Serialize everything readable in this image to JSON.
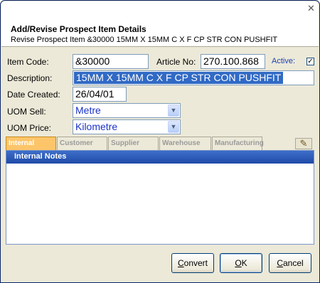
{
  "header": {
    "close_glyph": "✕",
    "title": "Add/Revise Prospect Item Details",
    "subtitle": "Revise Prospect Item &30000 15MM X 15MM C X F CP STR CON PUSHFIT"
  },
  "form": {
    "item_code_label": "Item Code:",
    "item_code_value": "&30000",
    "article_no_label": "Article No:",
    "article_no_value": "270.100.868",
    "active_label": "Active:",
    "active_checked": "✓",
    "description_label": "Description:",
    "description_value": "15MM X 15MM C X F CP STR CON PUSHFIT",
    "date_created_label": "Date Created:",
    "date_created_value": "26/04/01",
    "uom_sell_label": "UOM Sell:",
    "uom_sell_value": "Metre",
    "uom_price_label": "UOM Price:",
    "uom_price_value": "Kilometre",
    "dropdown_arrow": "▼"
  },
  "tabs": [
    {
      "label": "Internal"
    },
    {
      "label": "Customer"
    },
    {
      "label": "Supplier"
    },
    {
      "label": "Warehouse"
    },
    {
      "label": "Manufacturing"
    }
  ],
  "tab_edit_glyph": "✎",
  "notes": {
    "header": "Internal Notes"
  },
  "buttons": {
    "convert_first": "C",
    "convert_rest": "onvert",
    "ok_first": "O",
    "ok_rest": "K",
    "cancel_first": "C",
    "cancel_rest": "ancel"
  },
  "colors": {
    "active_tab": "#fcc56a",
    "notes_header": "#1f4aa8",
    "selection": "#316ac5",
    "dropdown_text": "#1a32c8"
  }
}
